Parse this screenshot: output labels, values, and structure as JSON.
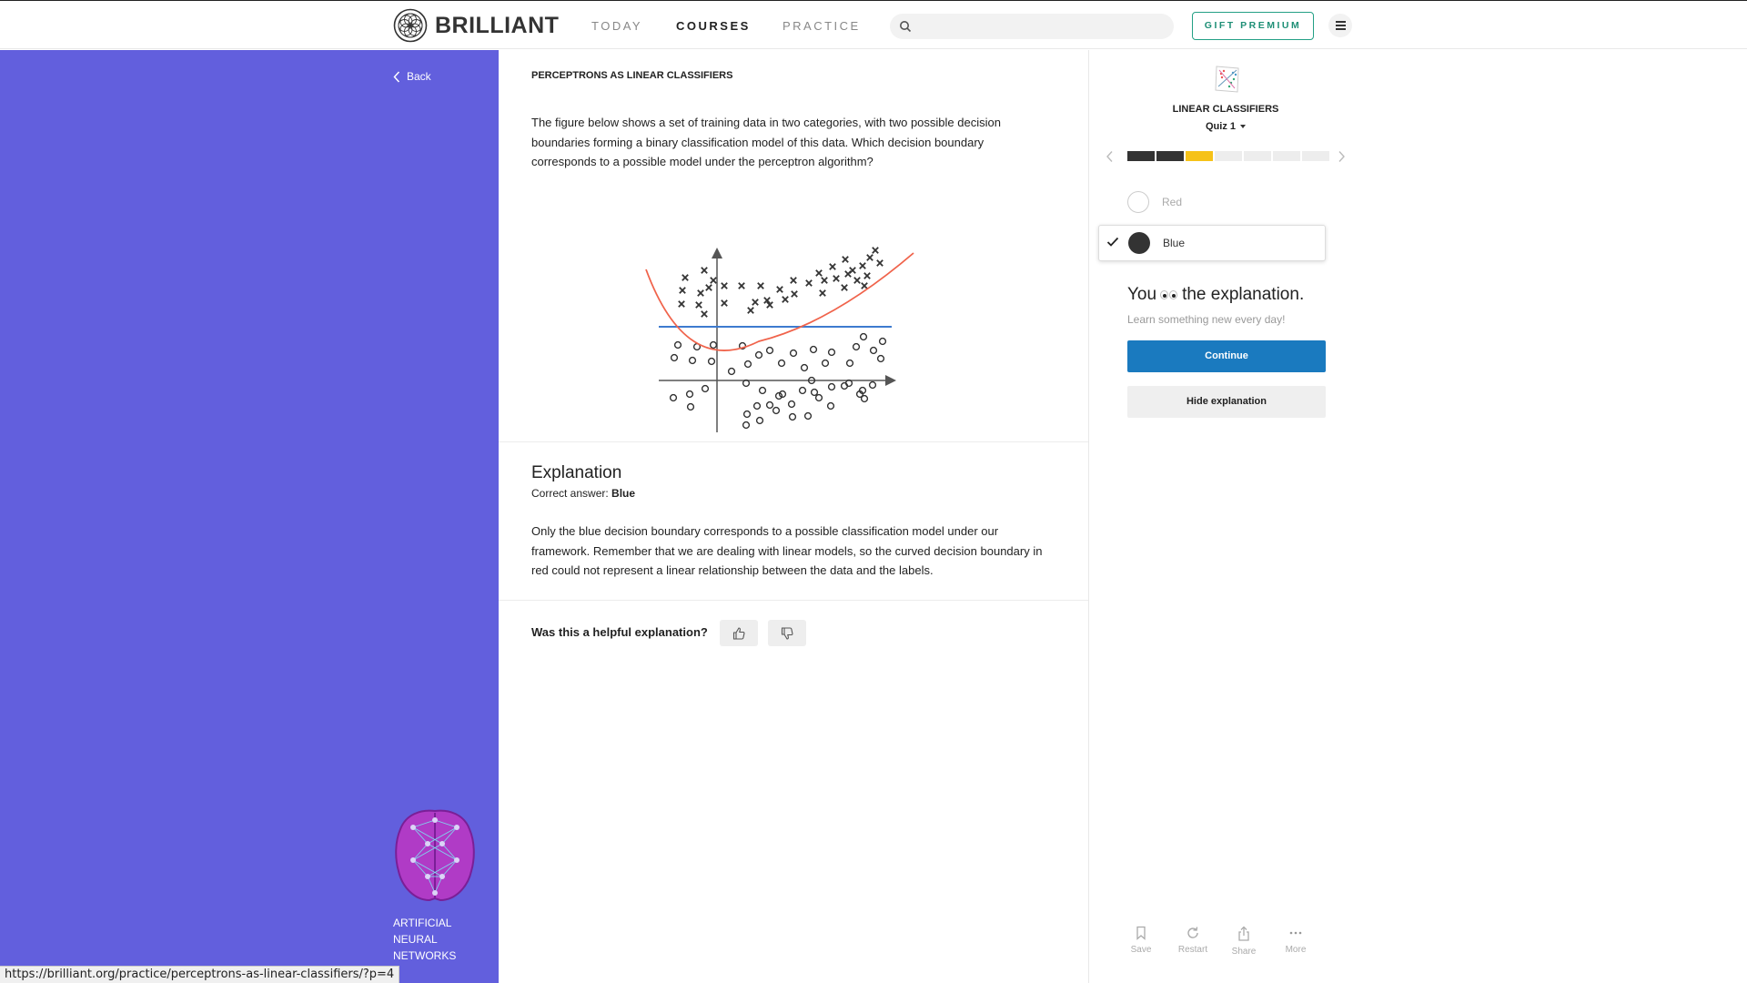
{
  "nav": {
    "brand": "BRILLIANT",
    "links": [
      "TODAY",
      "COURSES",
      "PRACTICE"
    ],
    "active_link": "COURSES",
    "search_placeholder": "",
    "gift_label": "GIFT PREMIUM"
  },
  "sidebar": {
    "back_label": "Back",
    "course_title": "ARTIFICIAL NEURAL NETWORKS"
  },
  "problem": {
    "title": "PERCEPTRONS AS LINEAR CLASSIFIERS",
    "text": "The figure below shows a set of training data in two categories, with two possible decision boundaries forming a binary classification model of this data. Which decision boundary corresponds to a possible model under the perceptron algorithm?",
    "figure": {
      "series": [
        {
          "marker": "x",
          "color": "#333333"
        },
        {
          "marker": "o",
          "color": "#333333"
        }
      ],
      "boundaries": [
        {
          "name": "Red",
          "shape": "curve",
          "color": "#f0634b"
        },
        {
          "name": "Blue",
          "shape": "line",
          "color": "#3d7bcf"
        }
      ]
    }
  },
  "explanation": {
    "title": "Explanation",
    "correct_prefix": "Correct answer: ",
    "correct_answer": "Blue",
    "text": "Only the blue decision boundary corresponds to a possible classification model under our framework. Remember that we are dealing with linear models, so the curved decision boundary in red could not represent a linear relationship between the data and the labels.",
    "helpful_question": "Was this a helpful explanation?"
  },
  "quiz": {
    "topic": "LINEAR CLASSIFIERS",
    "name": "Quiz 1",
    "progress": [
      {
        "state": "done",
        "color": "#333333"
      },
      {
        "state": "done",
        "color": "#333333"
      },
      {
        "state": "current",
        "color": "#f6c218"
      },
      {
        "state": "todo",
        "color": "#ededed"
      },
      {
        "state": "todo",
        "color": "#ededed"
      },
      {
        "state": "todo",
        "color": "#ededed"
      },
      {
        "state": "todo",
        "color": "#ededed"
      }
    ],
    "options": [
      {
        "label": "Red",
        "selected": false
      },
      {
        "label": "Blue",
        "selected": true
      }
    ],
    "result_prefix": "You",
    "result_suffix": "the explanation.",
    "tagline": "Learn something new every day!",
    "continue_label": "Continue",
    "hide_label": "Hide explanation",
    "actions": [
      "Save",
      "Restart",
      "Share",
      "More"
    ]
  },
  "status_url": "https://brilliant.org/practice/perceptrons-as-linear-classifiers/?p=4",
  "colors": {
    "sidebar_bg": "#625fdd",
    "accent_green": "#23a085",
    "continue_blue": "#1a7abf"
  }
}
